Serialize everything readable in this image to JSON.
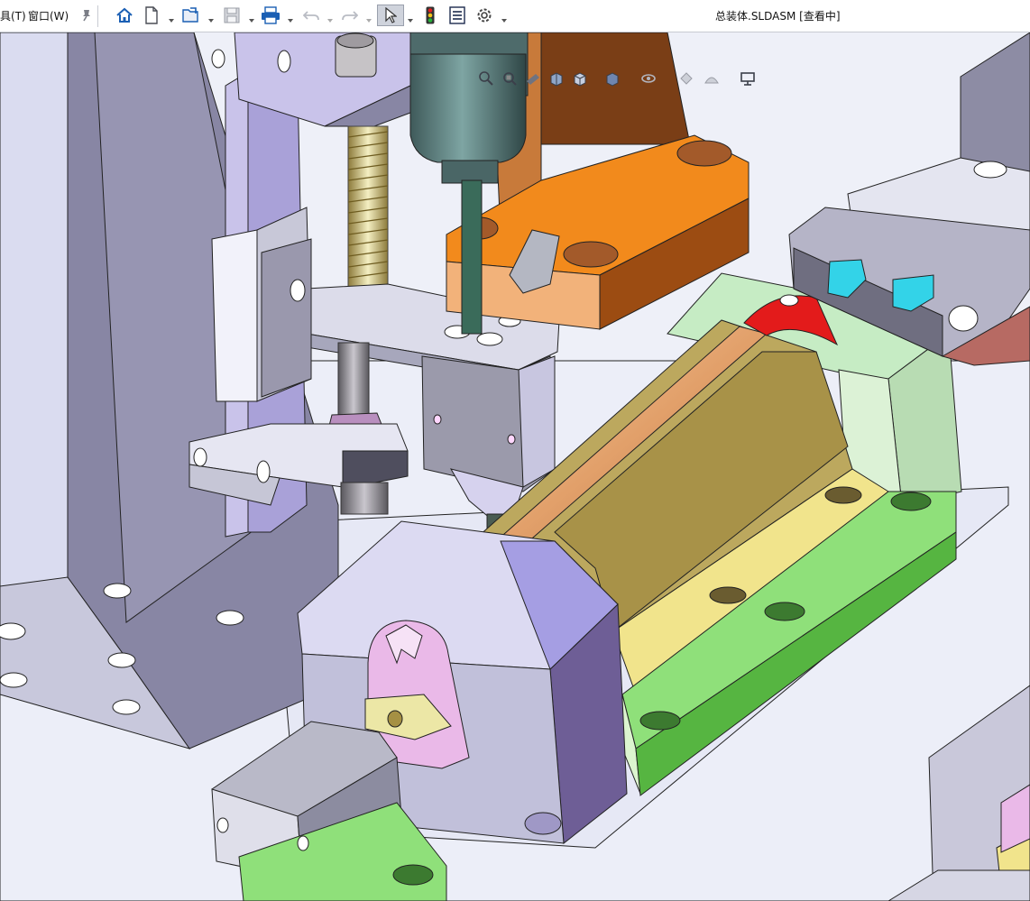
{
  "menu": {
    "tools_label": "具(T)",
    "window_label": "窗口(W)"
  },
  "document": {
    "title": "总装体.SLDASM [查看中]"
  },
  "toolbar": {
    "icons": [
      "pin-icon",
      "home-icon",
      "new-icon",
      "open-icon",
      "save-icon",
      "print-icon",
      "undo-icon",
      "redo-icon",
      "select-icon",
      "traffic-light-icon",
      "file-properties-icon",
      "options-icon"
    ]
  },
  "heads_up_toolbar": {
    "icons": [
      "zoom-to-fit-icon",
      "zoom-area-icon",
      "previous-view-icon",
      "section-view-icon",
      "view-orientation-icon",
      "display-style-icon",
      "hide-show-icon",
      "edit-appearance-icon",
      "apply-scene-icon",
      "view-settings-icon"
    ]
  },
  "colors": {
    "background": "#eef0f8",
    "frame_gray": "#8a87a6",
    "lavender": "#c9c3ea",
    "orange": "#f28a1c",
    "yellow": "#f1e48c",
    "green": "#8fe07a",
    "mint": "#c6ecc4",
    "red": "#e31b1b",
    "copper": "#e2a06a",
    "cyan": "#33d3e8",
    "pink": "#eab9e8"
  }
}
